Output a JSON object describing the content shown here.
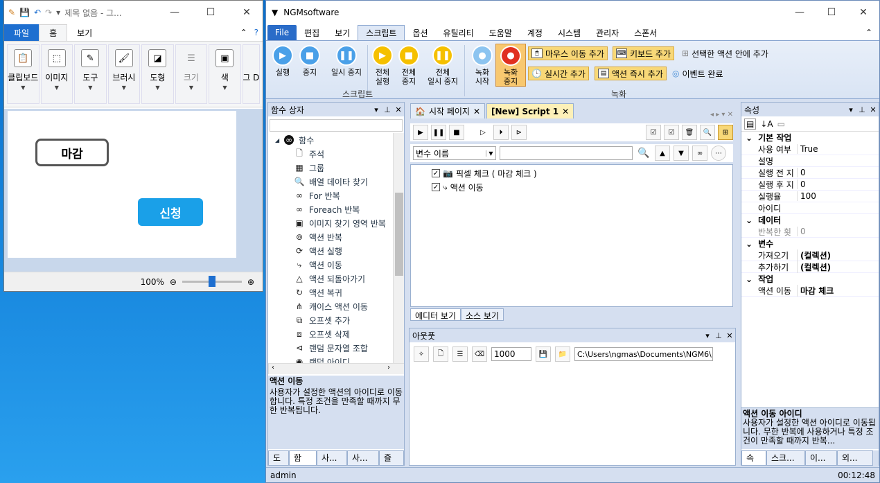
{
  "paint": {
    "title": "제목 없음 - 그...",
    "tabs": [
      "파일",
      "홈",
      "보기"
    ],
    "ribbon": [
      {
        "label": "클립보드",
        "icon": "clipboard-icon"
      },
      {
        "label": "이미지",
        "icon": "image-icon"
      },
      {
        "label": "도구",
        "icon": "tools-icon"
      },
      {
        "label": "브러시",
        "icon": "brush-icon"
      },
      {
        "label": "도형",
        "icon": "shapes-icon"
      },
      {
        "label": "크기",
        "icon": "size-icon"
      },
      {
        "label": "색",
        "icon": "color-icon"
      },
      {
        "label": "그 D",
        "icon": "paint3d-icon"
      }
    ],
    "canvas_button_1": "마감",
    "canvas_button_2": "신청",
    "zoom": "100%"
  },
  "ngm": {
    "title": "NGMsoftware",
    "menu": [
      "File",
      "편집",
      "보기",
      "스크립트",
      "옵션",
      "유틸리티",
      "도움말",
      "계정",
      "시스템",
      "관리자",
      "스폰서"
    ],
    "ribbon_script": [
      {
        "label": "실행",
        "glyph": "▶"
      },
      {
        "label": "중지",
        "glyph": "■"
      },
      {
        "label": "일시 중지",
        "glyph": "❚❚"
      },
      {
        "label": "전체\n실행",
        "glyph": "▶"
      },
      {
        "label": "전체\n중지",
        "glyph": "■"
      },
      {
        "label": "전체\n일시 중지",
        "glyph": "❚❚"
      }
    ],
    "ribbon_record": [
      {
        "label": "녹화\n시작"
      },
      {
        "label": "녹화\n중지"
      }
    ],
    "record_buttons": [
      "마우스 이동 추가",
      "키보드 추가",
      "선택한 액션 안에 추가",
      "실시간 추가",
      "액션 즉시 추가",
      "이벤트 완료"
    ],
    "group_script": "스크립트",
    "group_record": "녹화",
    "left_panel": {
      "title": "함수 상자",
      "root": "함수",
      "items": [
        "주석",
        "그룹",
        "배열 데이타 찾기",
        "For 반복",
        "Foreach 반복",
        "이미지 찾기 영역 반복",
        "액션 반복",
        "액션 실행",
        "액션 이동",
        "액션 되돌아가기",
        "액션 복귀",
        "캐이스 액션 이동",
        "오프셋 추가",
        "오프셋 삭제",
        "랜덤 문자열 조합",
        "랜덤 아이디"
      ],
      "desc_title": "액션 이동",
      "desc_text": "사용자가 설정한 액션의 아이디로 이동합니다. 특정 조건을 만족할 때까지 무한 반복됩니다.",
      "bottom_tabs": [
        "도",
        "함",
        "사...",
        "사...",
        "즐"
      ]
    },
    "doc": {
      "tabs": [
        "시작 페이지",
        "[New] Script 1"
      ],
      "combo": "변수 이름",
      "rows": [
        "픽셀 체크 ( 마감 체크 )",
        "액션 이동"
      ],
      "view_tabs": [
        "에디터 보기",
        "소스 보기"
      ]
    },
    "output": {
      "title": "아웃풋",
      "count": "1000",
      "path": "C:\\Users\\ngmas\\Documents\\NGM6\\"
    },
    "props": {
      "title": "속성",
      "cat1": "기본 작업",
      "rows1": [
        {
          "k": "사용 여부",
          "v": "True"
        },
        {
          "k": "설명",
          "v": ""
        },
        {
          "k": "실행 전 지",
          "v": "0"
        },
        {
          "k": "실행 후 지",
          "v": "0"
        },
        {
          "k": "실행율",
          "v": "100"
        },
        {
          "k": "아이디",
          "v": ""
        }
      ],
      "cat2": "데이터",
      "rows2": [
        {
          "k": "반복한 횟",
          "v": "0"
        }
      ],
      "cat3": "변수",
      "rows3": [
        {
          "k": "가져오기",
          "v": "(컬렉션)"
        },
        {
          "k": "추가하기",
          "v": "(컬렉션)"
        }
      ],
      "cat4": "작업",
      "rows4": [
        {
          "k": "액션 이동",
          "v": "마감 체크"
        }
      ],
      "desc_title": "액션 이동 아이디",
      "desc_text": "사용자가 설정한 액션 아이디로 이동됩니다. 무한 반복에 사용하거나 특정 조건이 만족할 때까지 반복...",
      "bottom_tabs": [
        "속",
        "스크...",
        "이...",
        "외..."
      ]
    },
    "status_user": "admin",
    "status_time": "00:12:48"
  }
}
